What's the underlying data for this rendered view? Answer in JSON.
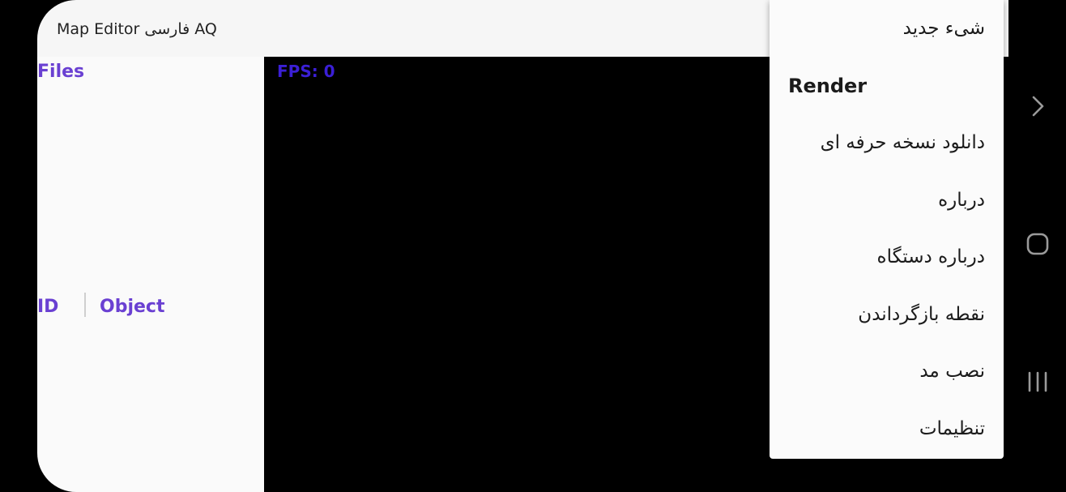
{
  "app": {
    "title": "Map Editor فارسی AQ"
  },
  "left_panel": {
    "files_label": "Files",
    "table_headers": {
      "id": "ID",
      "object": "Object"
    }
  },
  "canvas": {
    "fps_text": "FPS: 0"
  },
  "menu": {
    "items": [
      {
        "label": "شیء جدید"
      },
      {
        "label": "Render"
      },
      {
        "label": "دانلود نسخه حرفه ای"
      },
      {
        "label": "درباره"
      },
      {
        "label": "درباره دستگاه"
      },
      {
        "label": "نقطه بازگرداندن"
      },
      {
        "label": "نصب مد"
      },
      {
        "label": "تنظیمات"
      }
    ]
  },
  "navigation_bar": {
    "buttons": [
      {
        "icon": "chevron-right-icon"
      },
      {
        "icon": "home-icon"
      },
      {
        "icon": "recents-icon"
      }
    ]
  },
  "colors": {
    "accent": "#6a40d2",
    "fps": "#3b1fd6",
    "appbar": "#f6f6f6",
    "menu_bg": "#fbfbfb"
  }
}
